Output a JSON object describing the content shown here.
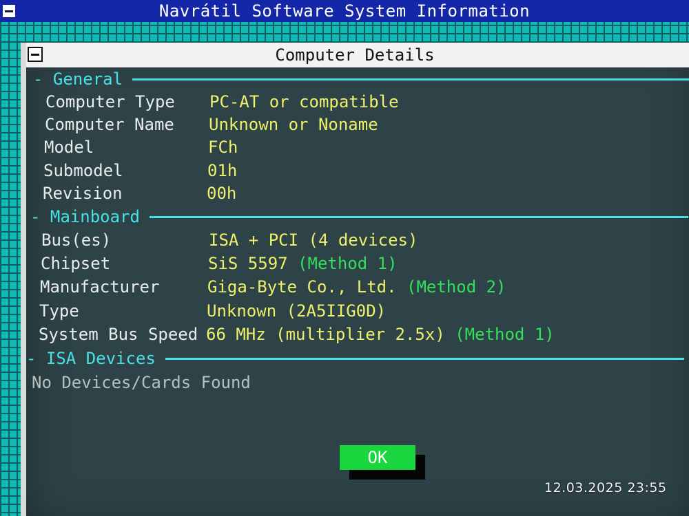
{
  "app": {
    "title": "Navrátil Software System Information"
  },
  "dialog": {
    "title": "Computer Details",
    "sections": {
      "general": {
        "header": "- General",
        "rows": [
          {
            "label": "Computer Type",
            "value": "PC-AT or compatible"
          },
          {
            "label": "Computer Name",
            "value": "Unknown or Noname"
          },
          {
            "label": "Model",
            "value": "FCh"
          },
          {
            "label": "Submodel",
            "value": "01h"
          },
          {
            "label": "Revision",
            "value": "00h"
          }
        ]
      },
      "mainboard": {
        "header": "- Mainboard",
        "rows": [
          {
            "label": "Bus(es)",
            "value": "ISA + PCI (4 devices)",
            "note": ""
          },
          {
            "label": "Chipset",
            "value": "SiS 5597",
            "note": "(Method 1)"
          },
          {
            "label": "Manufacturer",
            "value": "Giga-Byte Co., Ltd.",
            "note": "(Method 2)"
          },
          {
            "label": "Type",
            "value": "Unknown (2A5IIG0D)",
            "note": ""
          },
          {
            "label": "System Bus Speed",
            "value": "66 MHz (multiplier 2.5x)",
            "note": "(Method 1)"
          }
        ]
      },
      "isa": {
        "header": "- ISA Devices",
        "empty_text": "No Devices/Cards Found"
      }
    },
    "ok_label": "OK"
  },
  "overlay": {
    "timestamp": "12.03.2025 23:55"
  },
  "colors": {
    "title_bar": "#1327a8",
    "section_header": "#47e1e6",
    "value_text": "#eef06a",
    "note_text": "#33e05a",
    "ok_button": "#1ad63e",
    "dialog_bg": "#2e4347",
    "desktop": "#12b9b4"
  }
}
